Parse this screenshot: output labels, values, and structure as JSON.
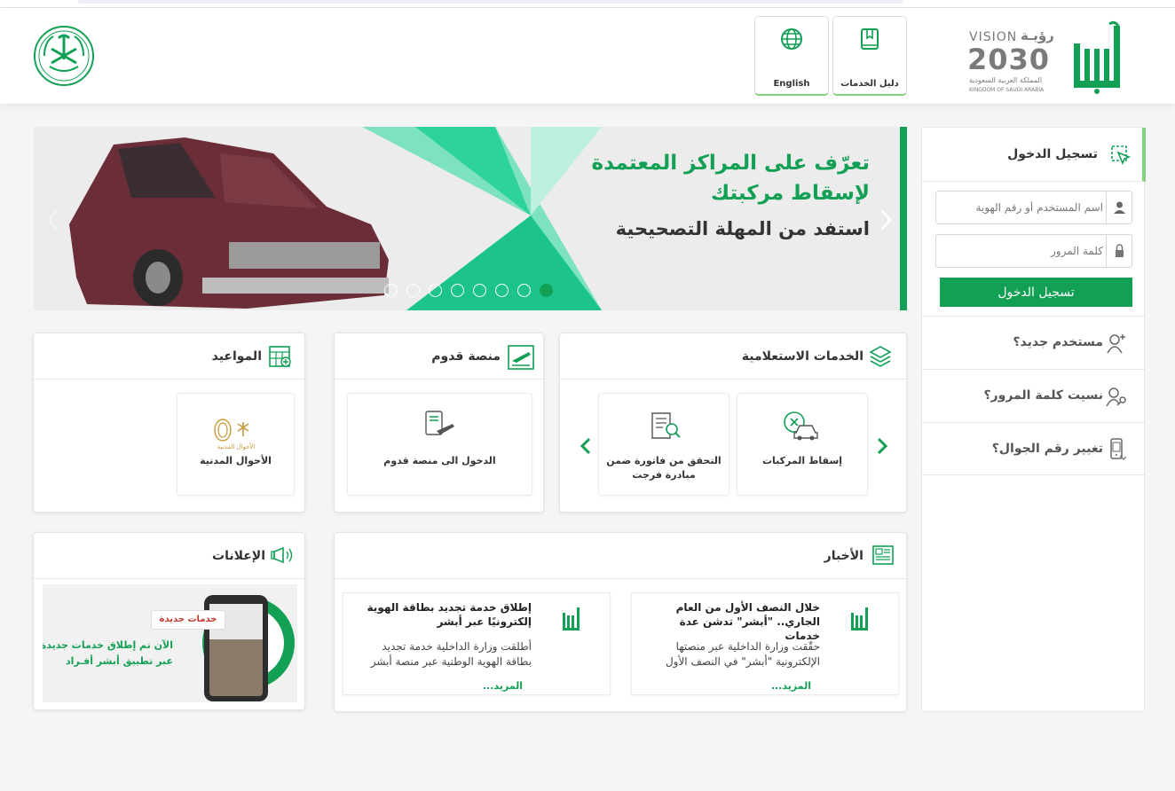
{
  "header": {
    "services_guide_label": "دليل الخدمات",
    "english_label": "English",
    "vision_word": "VISION",
    "vision_arabic": "رؤيـة",
    "vision_year": "2030",
    "vision_kingdom_ar": "المملكة العربية السعودية",
    "vision_kingdom_en": "KINGDOM OF SAUDI ARABIA"
  },
  "banner": {
    "line1": "تعرّف على المراكز المعتمدة",
    "line2": "لإسقاط مركبتك",
    "line3": "استفد من المهلة التصحيحية",
    "slide_count": 8,
    "active_slide": 8
  },
  "login": {
    "title": "تسجيل الدخول",
    "username_placeholder": "اسم المستخدم أو رقم الهوية",
    "password_placeholder": "كلمة المرور",
    "button_label": "تسجيل الدخول"
  },
  "side_links": {
    "new_user": "مستخدم جديد؟",
    "forgot_password": "نسيت كلمة المرور؟",
    "change_mobile": "تغيير رقم الجوال؟"
  },
  "inquiry": {
    "title": "الخدمات الاستعلامية",
    "tiles": [
      {
        "label": "إسقاط المركبات"
      },
      {
        "label": "التحقق من فاتورة ضمن مبادرة فرجت"
      }
    ]
  },
  "arrival": {
    "title": "منصة قدوم",
    "tile_label": "الدخول الى منصة قدوم"
  },
  "appointments": {
    "title": "المواعيد",
    "tile_label": "الأحوال المدنية",
    "tile_logo_text": "الأحوال المدنية"
  },
  "news": {
    "title": "الأخبار",
    "items": [
      {
        "title": "خلال النصف الأول من العام الجاري.. \"أبشر\" تدشن عدة خدمات",
        "desc": "حقّقت وزارة الداخلية عبر منصتها الإلكترونية \"أبشر\" في النصف الأول",
        "more": "المزيد..."
      },
      {
        "title": "إطلاق خدمة تجديد بطاقة الهوية إلكترونيًا عبر أبشر",
        "desc": "أطلقت وزارة الداخلية خدمة تجديد بطاقة الهوية الوطنية عبر منصة أبشر",
        "more": "المزيد..."
      }
    ]
  },
  "ads": {
    "title": "الإعلانات",
    "badge": "خدمات جديدة",
    "line1": "الآن تم إطلاق خدمات جديدة",
    "line2": "عبر تطبيق أبشر أفـراد"
  },
  "colors": {
    "brand_green": "#12a054",
    "accent_light_green": "#7fd37f"
  }
}
